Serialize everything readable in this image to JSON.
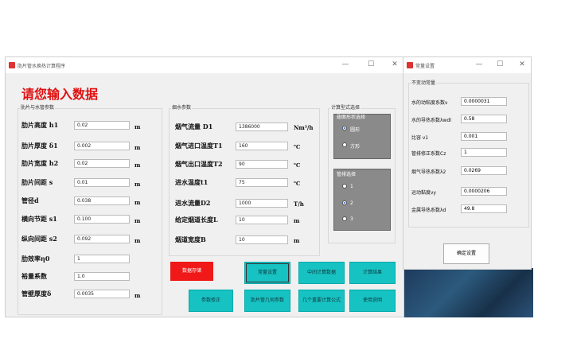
{
  "main_window": {
    "title": "肋片管水换热计算程序",
    "heading": "请您输入数据",
    "fin_group": {
      "label": "肋片与水管参数",
      "fields": [
        {
          "label": "肋片高度 h1",
          "value": "0.02",
          "unit": "m"
        },
        {
          "label": "肋片厚度 δ1",
          "value": "0.002",
          "unit": "m"
        },
        {
          "label": "肋片宽度 h2",
          "value": "0.02",
          "unit": "m"
        },
        {
          "label": "肋片间距 s",
          "value": "0.01",
          "unit": "m"
        },
        {
          "label": "管径d",
          "value": "0.038",
          "unit": "m"
        },
        {
          "label": "横向节距 s1",
          "value": "0.100",
          "unit": "m"
        },
        {
          "label": "纵向间距 s2",
          "value": "0.092",
          "unit": "m"
        },
        {
          "label": "肋效率η0",
          "value": "1",
          "unit": ""
        },
        {
          "label": "裕量系数",
          "value": "1.0",
          "unit": ""
        },
        {
          "label": "管壁厚度δ",
          "value": "0.0035",
          "unit": "m"
        }
      ]
    },
    "flue_group": {
      "label": "烟水参数",
      "fields": [
        {
          "label": "烟气流量 D1",
          "value": "1386000",
          "unit": "Nm³/h"
        },
        {
          "label": "烟气进口温度T1",
          "value": "160",
          "unit": "℃"
        },
        {
          "label": "烟气出口温度T2",
          "value": "90",
          "unit": "℃"
        },
        {
          "label": "进水温度t1",
          "value": "75",
          "unit": "℃"
        },
        {
          "label": "进水流量D2",
          "value": "1000",
          "unit": "T/h"
        },
        {
          "label": "给定烟道长度L",
          "value": "10",
          "unit": "m"
        },
        {
          "label": "烟道宽度B",
          "value": "10",
          "unit": "m"
        }
      ]
    },
    "calc_group": {
      "label": "计算型式选择",
      "section_box": {
        "label": "翅面形状选择",
        "options": [
          {
            "label": "圆形",
            "selected": true
          },
          {
            "label": "方形",
            "selected": false
          }
        ]
      },
      "tube_box": {
        "label": "管排选择",
        "options": [
          {
            "label": "1",
            "selected": false
          },
          {
            "label": "2",
            "selected": true
          },
          {
            "label": "3",
            "selected": false
          }
        ]
      }
    },
    "buttons": {
      "save_data": "数据存储",
      "constants": "常量设置",
      "intermediate": "中间计算数据",
      "results": "计算结果",
      "param_correct": "参数修正",
      "fin_geometry": "肋片管几何参数",
      "formulas": "几个重要计算公式",
      "instructions": "使用说明"
    }
  },
  "const_window": {
    "title": "常量设置",
    "group_label": "不变动常量",
    "fields": [
      {
        "label": "水的动粘度系数ν",
        "value": "0.0000031"
      },
      {
        "label": "水的导热系数λwdl",
        "value": "0.58"
      },
      {
        "label": "比容 ν1",
        "value": "0.001"
      },
      {
        "label": "管排修正系数Cz",
        "value": "1"
      },
      {
        "label": "烟气导热系数λ2",
        "value": "0.0269"
      },
      {
        "label": "运动黏度νy",
        "value": "0.0000206"
      },
      {
        "label": "金属导热系数λd",
        "value": "49.8"
      }
    ],
    "confirm_button": "确定设置"
  },
  "colors": {
    "accent": "#17c2c2",
    "danger": "#f01818",
    "heading": "#e01010"
  }
}
